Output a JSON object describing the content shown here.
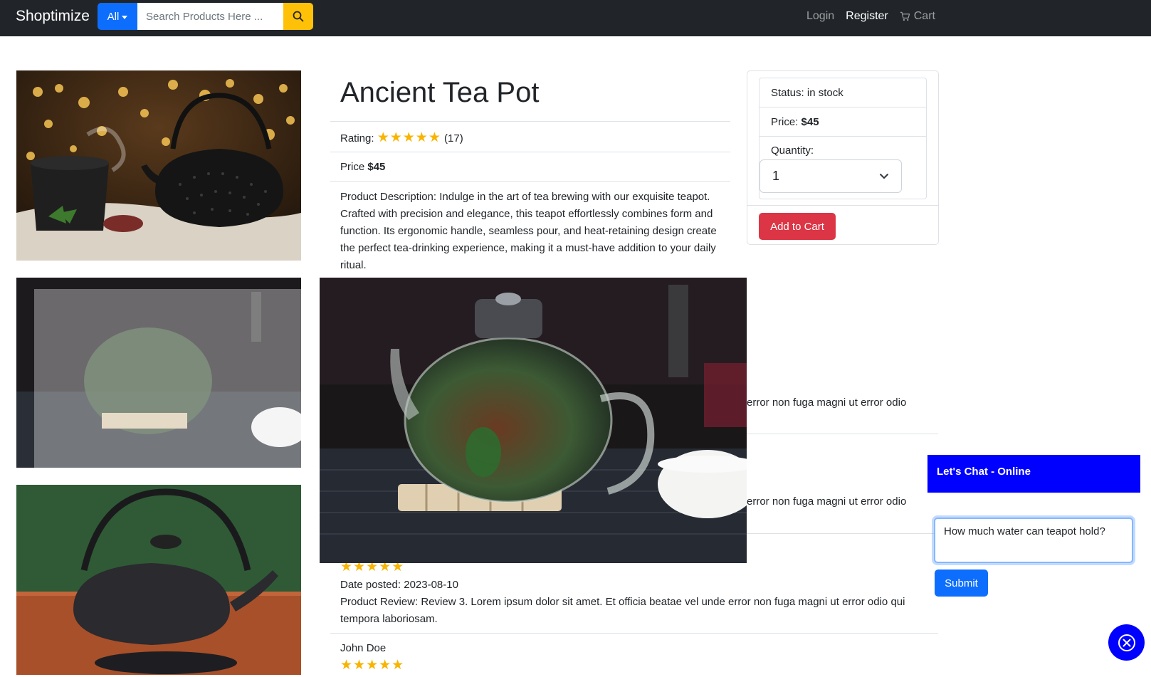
{
  "navbar": {
    "brand": "Shoptimize",
    "category_label": "All",
    "search_placeholder": "Search Products Here ...",
    "login": "Login",
    "register": "Register",
    "cart": "Cart"
  },
  "product": {
    "title": "Ancient Tea Pot",
    "rating_label": "Rating:",
    "rating_value": 5,
    "rating_stars": "★★★★★",
    "rating_count": "(17)",
    "price_label": "Price",
    "price": "$45",
    "description": "Product Description: Indulge in the art of tea brewing with our exquisite teapot. Crafted with precision and elegance, this teapot effortlessly combines form and function. Its ergonomic handle, seamless pour, and heat-retaining design create the perfect tea-drinking experience, making it a must-have addition to your daily ritual."
  },
  "purchase": {
    "status": "Status: in stock",
    "price_label": "Price:",
    "price": "$45",
    "quantity_label": "Quantity:",
    "quantity_value": "1",
    "add_to_cart": "Add to Cart"
  },
  "reviews": {
    "review1_fragment": "error non fuga magni ut error odio",
    "review2_fragment": "error non fuga magni ut error odio",
    "review3": {
      "stars": "★★★★★",
      "date": "Date posted: 2023-08-10",
      "text": "Product Review: Review 3. Lorem ipsum dolor sit amet. Et officia beatae vel unde error non fuga magni ut error odio qui tempora laboriosam."
    },
    "review4": {
      "author": "John Doe",
      "stars": "★★★★★"
    }
  },
  "chat": {
    "header": "Let's Chat - Online",
    "input_value": "How much water can teapot hold?",
    "submit": "Submit"
  },
  "colors": {
    "navbar_bg": "#212529",
    "primary": "#0d6efd",
    "search_button": "#ffc107",
    "danger": "#dc3545",
    "star": "#f8b400",
    "chat_header": "#0000ff"
  },
  "icons": [
    "search-icon",
    "cart-icon",
    "chevron-down-icon",
    "close-circle-icon"
  ]
}
